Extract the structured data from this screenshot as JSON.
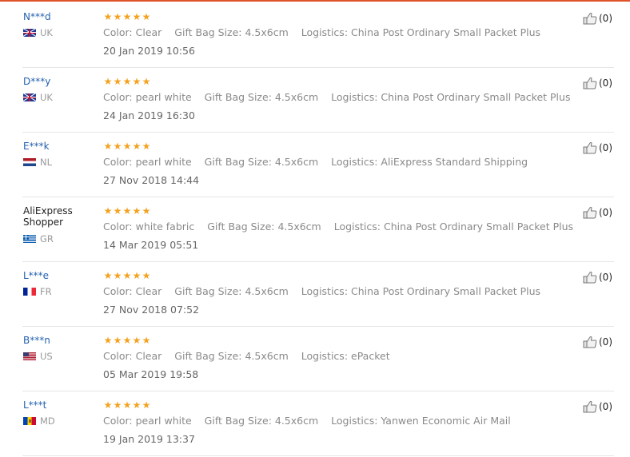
{
  "reviews": [
    {
      "user": "N***d",
      "country": "UK",
      "flag": "uk",
      "rating": 5,
      "color": "Color: Clear",
      "gift_bag_size": "Gift Bag Size: 4.5x6cm",
      "logistics": "Logistics: China Post Ordinary Small Packet Plus",
      "date": "20 Jan 2019 10:56",
      "helpful_count": "(0)"
    },
    {
      "user": "D***y",
      "country": "UK",
      "flag": "uk",
      "rating": 5,
      "color": "Color: pearl white",
      "gift_bag_size": "Gift Bag Size: 4.5x6cm",
      "logistics": "Logistics: China Post Ordinary Small Packet Plus",
      "date": "24 Jan 2019 16:30",
      "helpful_count": "(0)"
    },
    {
      "user": "E***k",
      "country": "NL",
      "flag": "nl",
      "rating": 5,
      "color": "Color: pearl white",
      "gift_bag_size": "Gift Bag Size: 4.5x6cm",
      "logistics": "Logistics: AliExpress Standard Shipping",
      "date": "27 Nov 2018 14:44",
      "helpful_count": "(0)"
    },
    {
      "user": "AliExpress Shopper",
      "country": "GR",
      "flag": "gr",
      "rating": 5,
      "color": "Color: white fabric",
      "gift_bag_size": "Gift Bag Size: 4.5x6cm",
      "logistics": "Logistics: China Post Ordinary Small Packet Plus",
      "date": "14 Mar 2019 05:51",
      "helpful_count": "(0)"
    },
    {
      "user": "L***e",
      "country": "FR",
      "flag": "fr",
      "rating": 5,
      "color": "Color: Clear",
      "gift_bag_size": "Gift Bag Size: 4.5x6cm",
      "logistics": "Logistics: China Post Ordinary Small Packet Plus",
      "date": "27 Nov 2018 07:52",
      "helpful_count": "(0)"
    },
    {
      "user": "B***n",
      "country": "US",
      "flag": "us",
      "rating": 5,
      "color": "Color: Clear",
      "gift_bag_size": "Gift Bag Size: 4.5x6cm",
      "logistics": "Logistics: ePacket",
      "date": "05 Mar 2019 19:58",
      "helpful_count": "(0)"
    },
    {
      "user": "L***t",
      "country": "MD",
      "flag": "md",
      "rating": 5,
      "color": "Color: pearl white",
      "gift_bag_size": "Gift Bag Size: 4.5x6cm",
      "logistics": "Logistics: Yanwen Economic Air Mail",
      "date": "19 Jan 2019 13:37",
      "helpful_count": "(0)"
    }
  ],
  "colors": {
    "star": "#f4a21f",
    "username_link": "#2562b0",
    "attribute_text": "#8a8a8a",
    "accent_bar": "#e0522a"
  },
  "icons": {
    "helpful": "thumbs-up-icon",
    "rating": "star-icon"
  }
}
